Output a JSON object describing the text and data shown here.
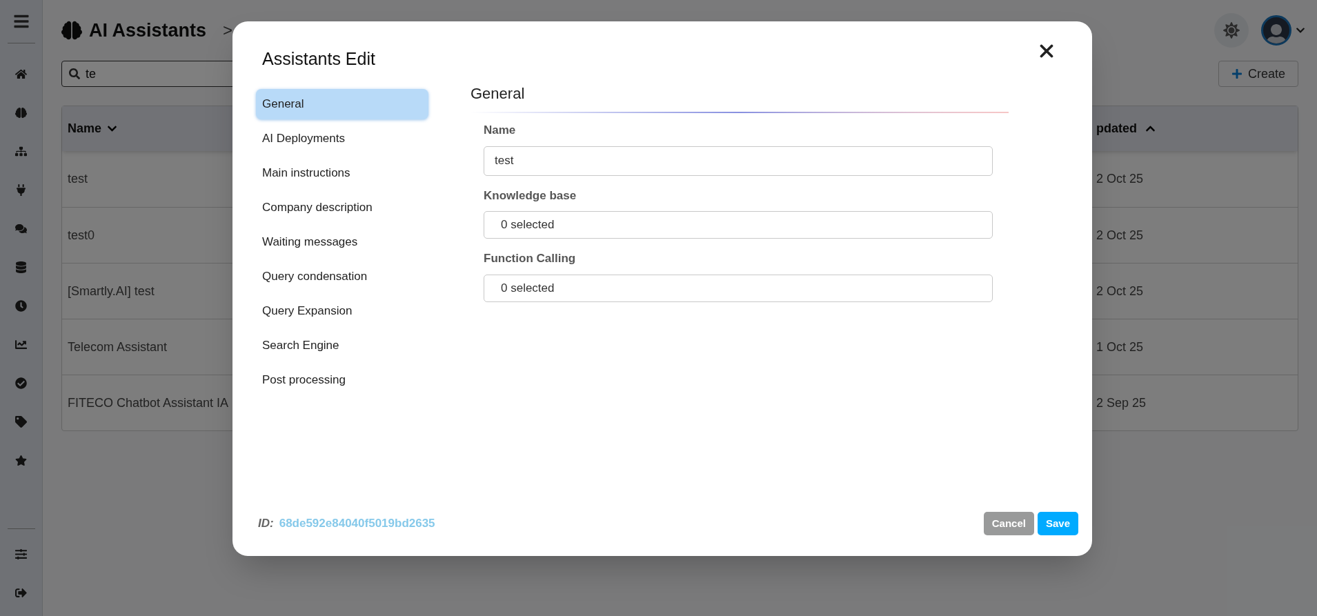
{
  "header": {
    "title": "AI Assistants",
    "breadcrumb_separator": ">"
  },
  "search": {
    "value": "te"
  },
  "create_button": {
    "label": "Create"
  },
  "table": {
    "columns": [
      {
        "label": "Name",
        "sort_ascending": false
      },
      {
        "label": "pdated",
        "sort_ascending": true
      }
    ],
    "rows": [
      {
        "name": "test",
        "updated": "2 Oct 25"
      },
      {
        "name": "test0",
        "updated": "2 Oct 25"
      },
      {
        "name": "[Smartly.AI] test",
        "updated": "2 Oct 25"
      },
      {
        "name": "Telecom Assistant",
        "updated": "1 Oct 25"
      },
      {
        "name": "FITECO Chatbot Assistant IA",
        "updated": "2 Sep 25"
      }
    ]
  },
  "dialog": {
    "title": "Assistants Edit",
    "nav": [
      {
        "label": "General",
        "selected": true
      },
      {
        "label": "AI Deployments",
        "selected": false
      },
      {
        "label": "Main instructions",
        "selected": false
      },
      {
        "label": "Company description",
        "selected": false
      },
      {
        "label": "Waiting messages",
        "selected": false
      },
      {
        "label": "Query condensation",
        "selected": false
      },
      {
        "label": "Query Expansion",
        "selected": false
      },
      {
        "label": "Search Engine",
        "selected": false
      },
      {
        "label": "Post processing",
        "selected": false
      }
    ],
    "section_title": "General",
    "fields": [
      {
        "label": "Name",
        "kind": "text",
        "value": "test"
      },
      {
        "label": "Knowledge base",
        "kind": "multiselect",
        "value": "0 selected"
      },
      {
        "label": "Function Calling",
        "kind": "multiselect",
        "value": "0 selected"
      }
    ],
    "id_label": "ID:",
    "id_value": "68de592e84040f5019bd2635",
    "buttons": [
      {
        "label": "Cancel",
        "kind": "secondary"
      },
      {
        "label": "Save",
        "kind": "primary"
      }
    ]
  }
}
